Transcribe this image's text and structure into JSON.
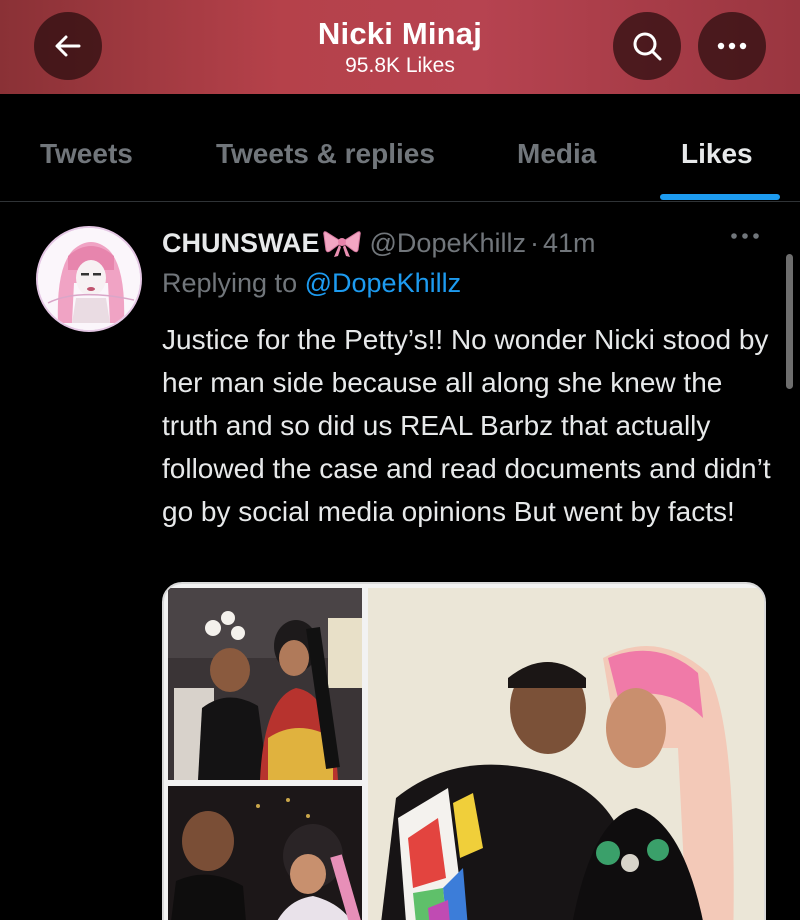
{
  "header": {
    "title": "Nicki Minaj",
    "subtitle": "95.8K Likes",
    "back_icon": "arrow-left-icon",
    "search_icon": "search-icon",
    "more_icon": "more-horizontal-icon"
  },
  "tabs": [
    {
      "label": "Tweets",
      "active": false
    },
    {
      "label": "Tweets & replies",
      "active": false
    },
    {
      "label": "Media",
      "active": false
    },
    {
      "label": "Likes",
      "active": true
    }
  ],
  "tweet": {
    "author_name": "CHUNSWAE",
    "author_emoji": "ribbon-icon",
    "handle": "@DopeKhillz",
    "separator": "·",
    "time": "41m",
    "replying_prefix": "Replying to",
    "replying_to": "@DopeKhillz",
    "text": "Justice for the Petty’s!! No wonder Nicki stood by her man side because all along she knew the truth and so did us REAL Barbz that actually followed the case and read documents and didn’t go by social media opinions But went by facts!",
    "more_icon": "more-horizontal-icon",
    "avatar": "profile-avatar",
    "media": [
      "photo-couple-1",
      "photo-couple-2",
      "photo-couple-3"
    ]
  },
  "colors": {
    "accent": "#1d9bf0",
    "header_gradient": "#b5414a",
    "background": "#000000",
    "secondary_text": "#71767b"
  }
}
